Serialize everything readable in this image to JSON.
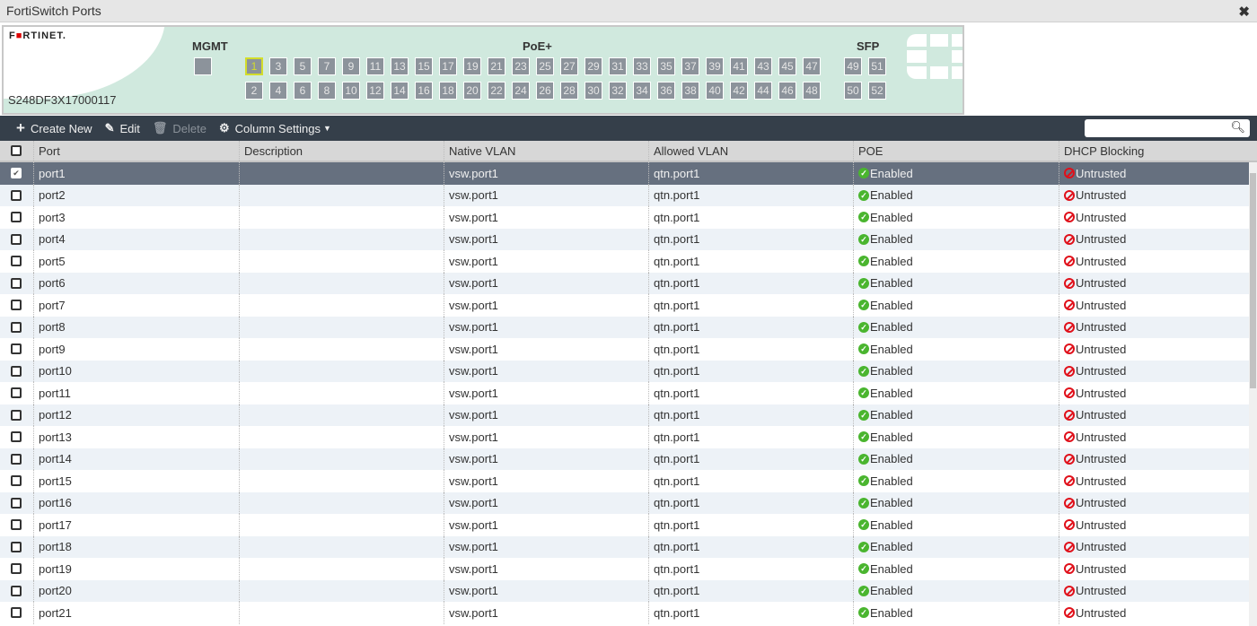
{
  "window": {
    "title": "FortiSwitch Ports",
    "close_icon": "close-icon"
  },
  "faceplate": {
    "logo": "FORTINET",
    "serial": "S248DF3X17000117",
    "groups": {
      "mgmt": "MGMT",
      "poe": "PoE+",
      "sfp": "SFP"
    },
    "selected_port": "1",
    "poe_ports_top": [
      "1",
      "3",
      "5",
      "7",
      "9",
      "11",
      "13",
      "15",
      "17",
      "19",
      "21",
      "23",
      "25",
      "27",
      "29",
      "31",
      "33",
      "35",
      "37",
      "39",
      "41",
      "43",
      "45",
      "47"
    ],
    "poe_ports_bottom": [
      "2",
      "4",
      "6",
      "8",
      "10",
      "12",
      "14",
      "16",
      "18",
      "20",
      "22",
      "24",
      "26",
      "28",
      "30",
      "32",
      "34",
      "36",
      "38",
      "40",
      "42",
      "44",
      "46",
      "48"
    ],
    "sfp_ports_top": [
      "49",
      "51"
    ],
    "sfp_ports_bottom": [
      "50",
      "52"
    ]
  },
  "toolbar": {
    "create_new": "Create New",
    "edit": "Edit",
    "delete": "Delete",
    "column_settings": "Column Settings",
    "search_placeholder": ""
  },
  "table": {
    "columns": [
      "Port",
      "Description",
      "Native VLAN",
      "Allowed VLAN",
      "POE",
      "DHCP Blocking"
    ],
    "rows": [
      {
        "port": "port1",
        "description": "",
        "native_vlan": "vsw.port1",
        "allowed_vlan": "qtn.port1",
        "poe": "Enabled",
        "dhcp": "Untrusted",
        "selected": true
      },
      {
        "port": "port2",
        "description": "",
        "native_vlan": "vsw.port1",
        "allowed_vlan": "qtn.port1",
        "poe": "Enabled",
        "dhcp": "Untrusted"
      },
      {
        "port": "port3",
        "description": "",
        "native_vlan": "vsw.port1",
        "allowed_vlan": "qtn.port1",
        "poe": "Enabled",
        "dhcp": "Untrusted"
      },
      {
        "port": "port4",
        "description": "",
        "native_vlan": "vsw.port1",
        "allowed_vlan": "qtn.port1",
        "poe": "Enabled",
        "dhcp": "Untrusted"
      },
      {
        "port": "port5",
        "description": "",
        "native_vlan": "vsw.port1",
        "allowed_vlan": "qtn.port1",
        "poe": "Enabled",
        "dhcp": "Untrusted"
      },
      {
        "port": "port6",
        "description": "",
        "native_vlan": "vsw.port1",
        "allowed_vlan": "qtn.port1",
        "poe": "Enabled",
        "dhcp": "Untrusted"
      },
      {
        "port": "port7",
        "description": "",
        "native_vlan": "vsw.port1",
        "allowed_vlan": "qtn.port1",
        "poe": "Enabled",
        "dhcp": "Untrusted"
      },
      {
        "port": "port8",
        "description": "",
        "native_vlan": "vsw.port1",
        "allowed_vlan": "qtn.port1",
        "poe": "Enabled",
        "dhcp": "Untrusted"
      },
      {
        "port": "port9",
        "description": "",
        "native_vlan": "vsw.port1",
        "allowed_vlan": "qtn.port1",
        "poe": "Enabled",
        "dhcp": "Untrusted"
      },
      {
        "port": "port10",
        "description": "",
        "native_vlan": "vsw.port1",
        "allowed_vlan": "qtn.port1",
        "poe": "Enabled",
        "dhcp": "Untrusted"
      },
      {
        "port": "port11",
        "description": "",
        "native_vlan": "vsw.port1",
        "allowed_vlan": "qtn.port1",
        "poe": "Enabled",
        "dhcp": "Untrusted"
      },
      {
        "port": "port12",
        "description": "",
        "native_vlan": "vsw.port1",
        "allowed_vlan": "qtn.port1",
        "poe": "Enabled",
        "dhcp": "Untrusted"
      },
      {
        "port": "port13",
        "description": "",
        "native_vlan": "vsw.port1",
        "allowed_vlan": "qtn.port1",
        "poe": "Enabled",
        "dhcp": "Untrusted"
      },
      {
        "port": "port14",
        "description": "",
        "native_vlan": "vsw.port1",
        "allowed_vlan": "qtn.port1",
        "poe": "Enabled",
        "dhcp": "Untrusted"
      },
      {
        "port": "port15",
        "description": "",
        "native_vlan": "vsw.port1",
        "allowed_vlan": "qtn.port1",
        "poe": "Enabled",
        "dhcp": "Untrusted"
      },
      {
        "port": "port16",
        "description": "",
        "native_vlan": "vsw.port1",
        "allowed_vlan": "qtn.port1",
        "poe": "Enabled",
        "dhcp": "Untrusted"
      },
      {
        "port": "port17",
        "description": "",
        "native_vlan": "vsw.port1",
        "allowed_vlan": "qtn.port1",
        "poe": "Enabled",
        "dhcp": "Untrusted"
      },
      {
        "port": "port18",
        "description": "",
        "native_vlan": "vsw.port1",
        "allowed_vlan": "qtn.port1",
        "poe": "Enabled",
        "dhcp": "Untrusted"
      },
      {
        "port": "port19",
        "description": "",
        "native_vlan": "vsw.port1",
        "allowed_vlan": "qtn.port1",
        "poe": "Enabled",
        "dhcp": "Untrusted"
      },
      {
        "port": "port20",
        "description": "",
        "native_vlan": "vsw.port1",
        "allowed_vlan": "qtn.port1",
        "poe": "Enabled",
        "dhcp": "Untrusted"
      },
      {
        "port": "port21",
        "description": "",
        "native_vlan": "vsw.port1",
        "allowed_vlan": "qtn.port1",
        "poe": "Enabled",
        "dhcp": "Untrusted"
      }
    ]
  },
  "colors": {
    "toolbar": "#353f4a",
    "selected_row": "#66707f",
    "faceplate": "#d0e9de",
    "enabled": "#4ab52f",
    "untrusted": "#e0101a"
  }
}
